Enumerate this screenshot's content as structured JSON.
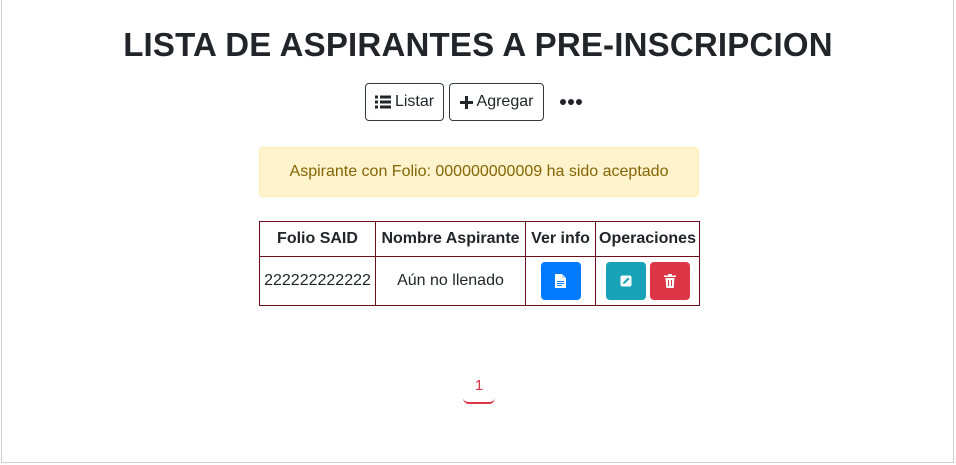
{
  "page": {
    "title": "LISTA DE ASPIRANTES A PRE-INSCRIPCION"
  },
  "toolbar": {
    "listar_label": "Listar",
    "agregar_label": "Agregar",
    "more_icon": "ellipsis-icon"
  },
  "alert": {
    "message": "Aspirante con Folio: 000000000009 ha sido aceptado",
    "color": "#856404",
    "background": "#fff3cd"
  },
  "table": {
    "headers": [
      "Folio SAID",
      "Nombre Aspirante",
      "Ver info",
      "Operaciones"
    ],
    "rows": [
      {
        "folio": "222222222222",
        "nombre": "Aún no llenado",
        "actions": {
          "view_icon": "document-icon",
          "edit_icon": "pencil-icon",
          "delete_icon": "trash-icon"
        }
      }
    ]
  },
  "pagination": {
    "current_page": "1"
  },
  "colors": {
    "primary": "#007bff",
    "info": "#17a2b8",
    "danger": "#dc3545",
    "table_border": "#6b0f1a"
  }
}
